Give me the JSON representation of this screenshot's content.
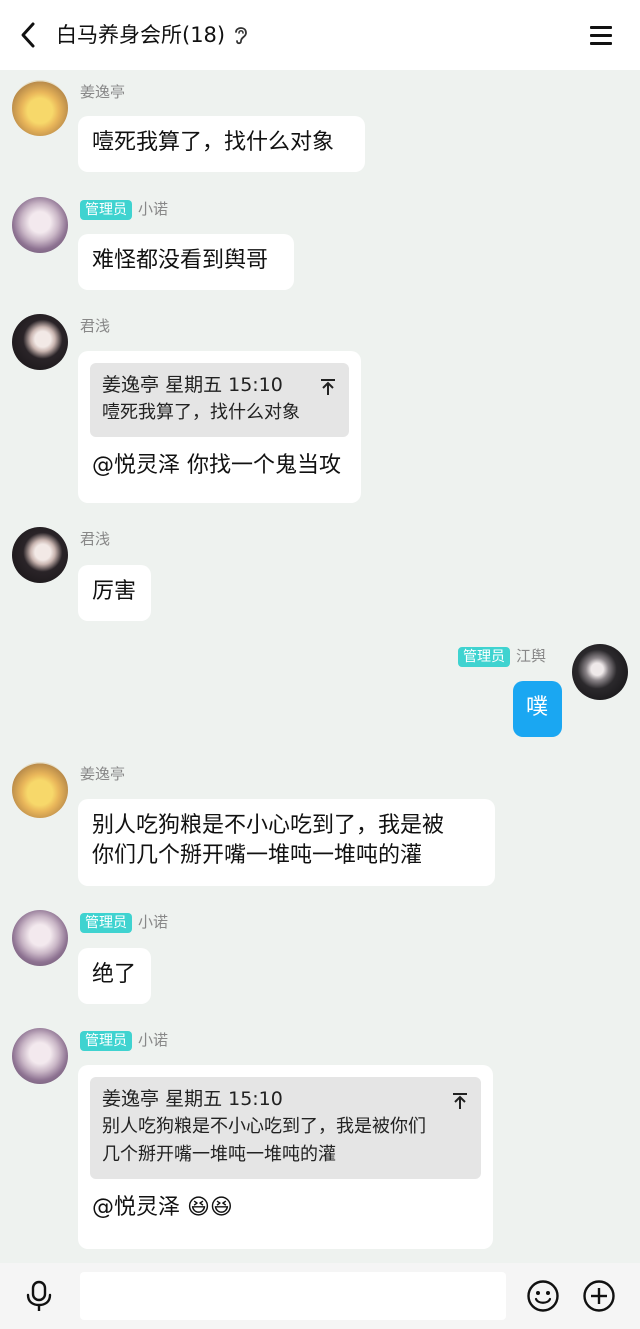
{
  "header": {
    "title": "白马养身会所(18)",
    "back_icon": "chevron-left-icon",
    "ear_icon": "ear-icon",
    "menu_icon": "hamburger-menu-icon"
  },
  "admin_badge": "管理员",
  "messages": [
    {
      "sender": "姜逸亭",
      "text": "噎死我算了，找什么对象"
    },
    {
      "sender": "小诺",
      "admin": true,
      "text": "难怪都没看到舆哥"
    },
    {
      "sender": "君浅",
      "quote": {
        "author": "姜逸亭",
        "time": "星期五 15:10",
        "text": "噎死我算了，找什么对象"
      },
      "text": "@悦灵泽 你找一个鬼当攻"
    },
    {
      "sender": "君浅",
      "text": "厉害"
    },
    {
      "sender": "江舆",
      "admin": true,
      "self": true,
      "text": "噗"
    },
    {
      "sender": "姜逸亭",
      "text_lines": [
        "别人吃狗粮是不小心吃到了，我是被",
        "你们几个掰开嘴一堆吨一堆吨的灌"
      ]
    },
    {
      "sender": "小诺",
      "admin": true,
      "text": "绝了"
    },
    {
      "sender": "小诺",
      "admin": true,
      "quote": {
        "author": "姜逸亭",
        "time": "星期五 15:10",
        "text_lines": [
          "别人吃狗粮是不小心吃到了，我是被你们",
          "几个掰开嘴一堆吨一堆吨的灌"
        ]
      },
      "text": "@悦灵泽 😆😆"
    }
  ],
  "input_bar": {
    "mic_icon": "microphone-icon",
    "emoji_icon": "emoji-icon",
    "plus_icon": "plus-circle-icon",
    "placeholder": ""
  }
}
